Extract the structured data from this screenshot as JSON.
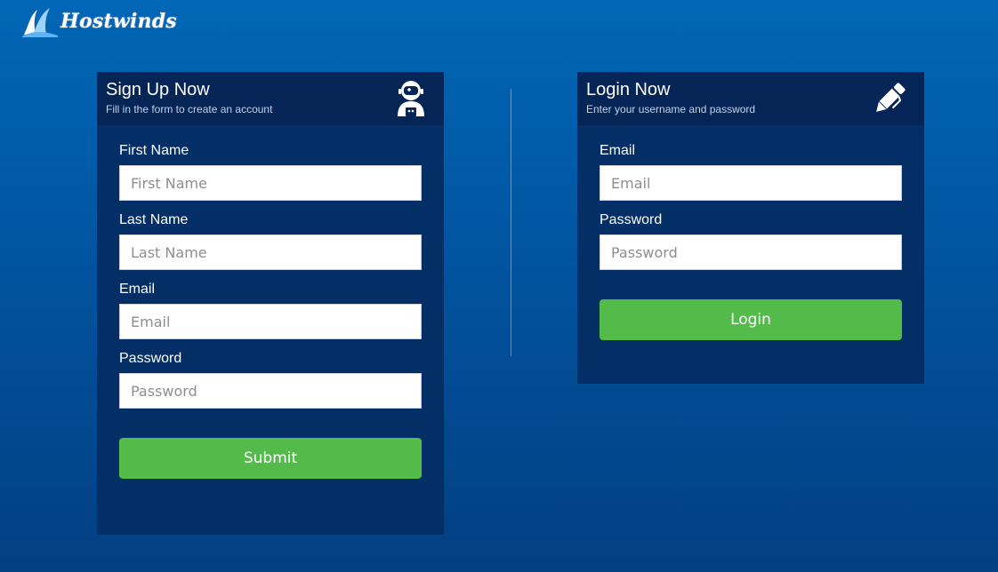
{
  "brand": {
    "name": "Hostwinds",
    "icon": "wave-logo-icon"
  },
  "colors": {
    "panel": "#032f66",
    "panel_header": "#042556",
    "button": "#53bb49"
  },
  "signup": {
    "title": "Sign Up Now",
    "subtitle": "Fill in the form to create an account",
    "icon": "astronaut-icon",
    "fields": [
      {
        "label": "First Name",
        "placeholder": "First Name",
        "value": ""
      },
      {
        "label": "Last Name",
        "placeholder": "Last Name",
        "value": ""
      },
      {
        "label": "Email",
        "placeholder": "Email",
        "value": ""
      },
      {
        "label": "Password",
        "placeholder": "Password",
        "value": ""
      }
    ],
    "submit_label": "Submit"
  },
  "login": {
    "title": "Login Now",
    "subtitle": "Enter your username and password",
    "icon": "pencil-icon",
    "fields": [
      {
        "label": "Email",
        "placeholder": "Email",
        "value": ""
      },
      {
        "label": "Password",
        "placeholder": "Password",
        "value": ""
      }
    ],
    "submit_label": "Login"
  }
}
